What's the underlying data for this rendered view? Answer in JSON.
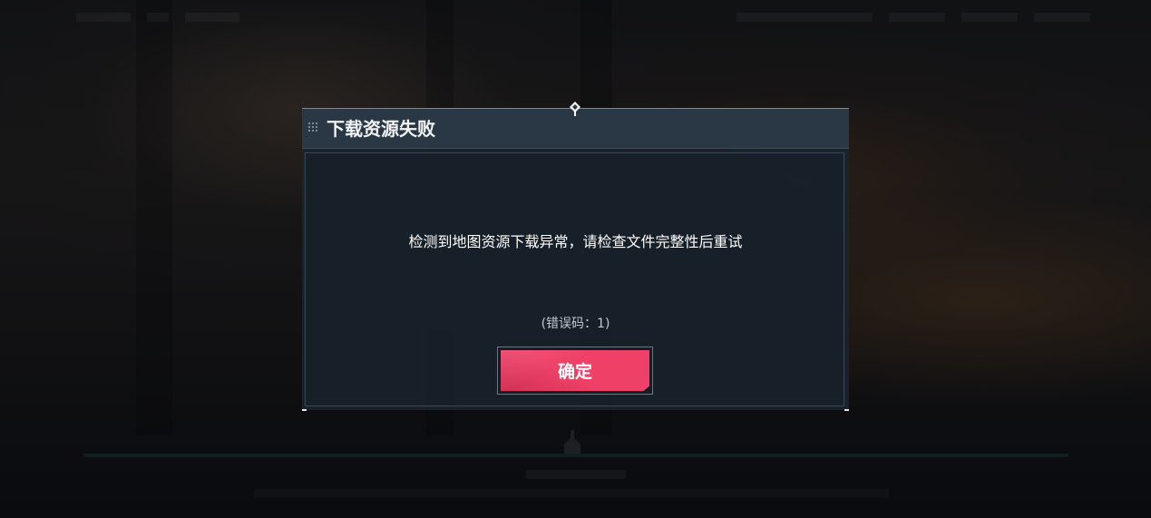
{
  "dialog": {
    "title": "下载资源失败",
    "message": "检测到地图资源下载异常，请检查文件完整性后重试",
    "error_code": "(错误码：1)",
    "confirm_label": "确定"
  },
  "icons": {
    "header": "grip-dots-icon",
    "ornament": "diamond-ornament-icon"
  },
  "colors": {
    "dialog_bg": "#1a222c",
    "header_bg": "#2a3745",
    "confirm_button": "#ef4168",
    "text_primary": "#ffffff",
    "text_secondary": "#c3c9cf"
  }
}
